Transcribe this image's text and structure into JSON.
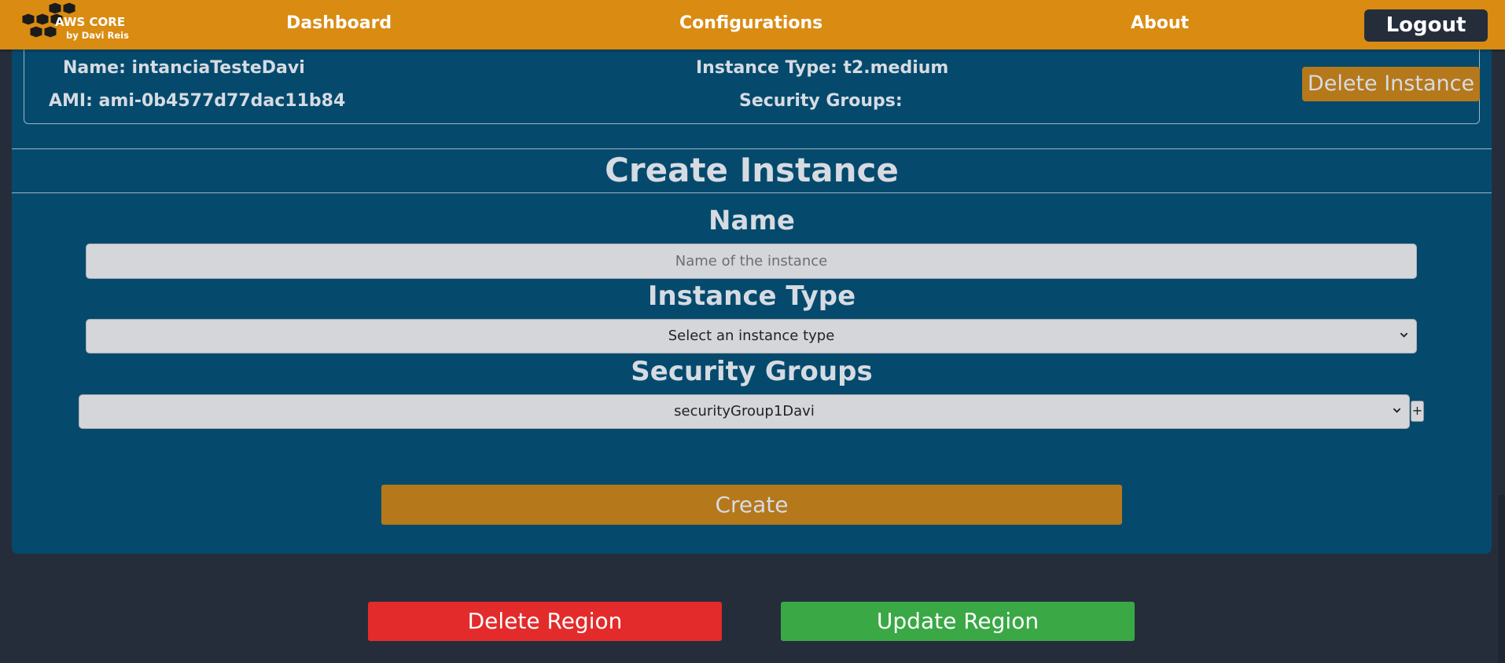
{
  "header": {
    "logo_title": "AWS CORE",
    "logo_subtitle": "by Davi Reis",
    "nav": {
      "dashboard": "Dashboard",
      "configurations": "Configurations",
      "about": "About"
    },
    "logout_label": "Logout"
  },
  "instance": {
    "name": "Name: intanciaTesteDavi",
    "ami": "AMI: ami-0b4577d77dac11b84",
    "instance_type": "Instance Type: t2.medium",
    "security_groups": "Security Groups:",
    "delete_label": "Delete Instance"
  },
  "create_form": {
    "title": "Create Instance",
    "name_label": "Name",
    "name_placeholder": "Name of the instance",
    "name_value": "",
    "type_label": "Instance Type",
    "type_selected": "Select an instance type",
    "sg_label": "Security Groups",
    "sg_selected": "securityGroup1Davi",
    "add_sg_label": "+",
    "create_label": "Create"
  },
  "region_actions": {
    "delete_label": "Delete Region",
    "update_label": "Update Region"
  },
  "colors": {
    "header": "#d98b12",
    "panel": "#054a6d",
    "background": "#252d3b",
    "accent_button": "#b5781a",
    "delete": "#e32b2b",
    "update": "#39a845"
  }
}
